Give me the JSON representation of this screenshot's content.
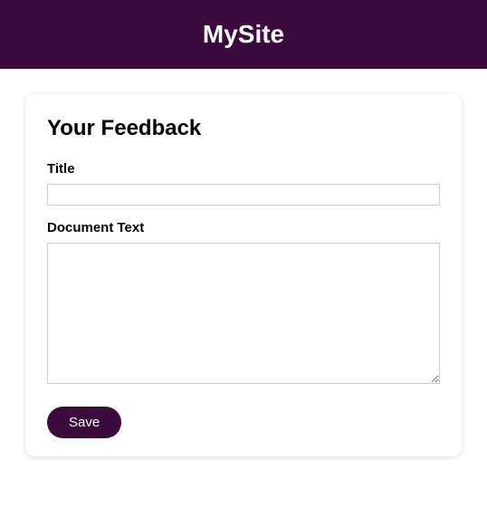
{
  "header": {
    "site_name": "MySite"
  },
  "form": {
    "heading": "Your Feedback",
    "title_label": "Title",
    "title_value": "",
    "document_text_label": "Document Text",
    "document_text_value": "",
    "save_label": "Save"
  },
  "colors": {
    "primary": "#3d0a3d",
    "text": "#000000",
    "border": "#cccccc",
    "background": "#ffffff"
  }
}
